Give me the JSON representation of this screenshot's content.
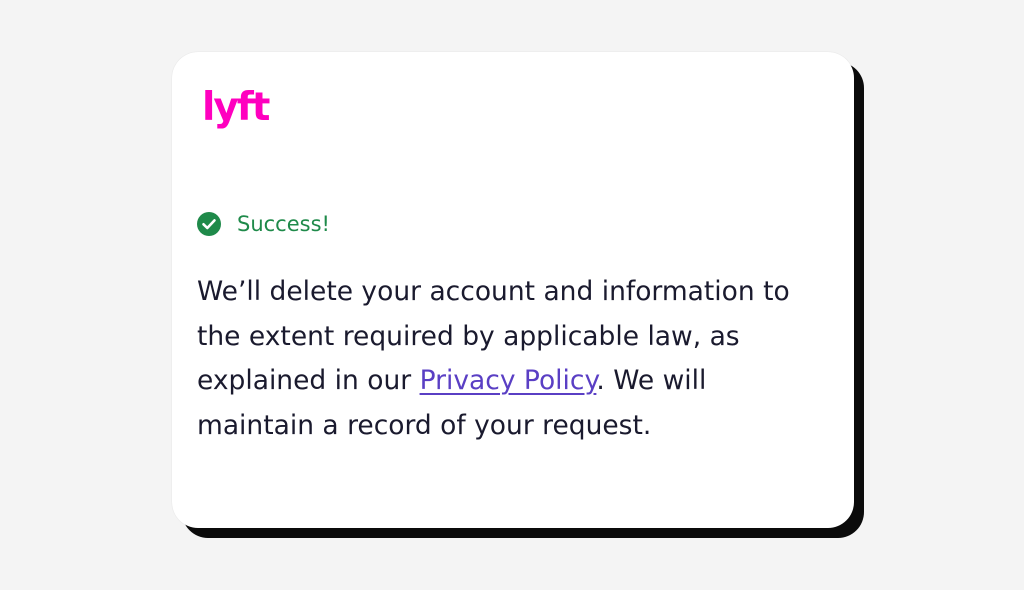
{
  "brand": {
    "logo_text": "lyft",
    "logo_color": "#ff00bf"
  },
  "status": {
    "icon": "check-circle-icon",
    "label": "Success!",
    "color": "#1f8a4a"
  },
  "message": {
    "before_link": "We’ll delete your account and information to the extent required by applicable law, as explained in our ",
    "link_text": "Privacy Policy",
    "after_link": ". We will maintain a record of your request.",
    "link_color": "#5a3fc4"
  }
}
